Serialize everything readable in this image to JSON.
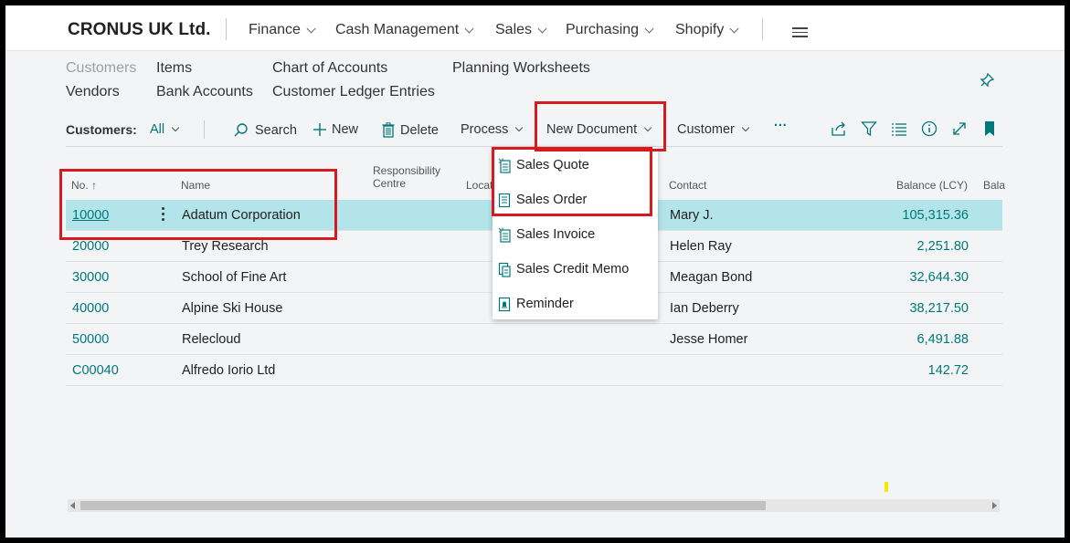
{
  "topnav": {
    "company": "CRONUS UK Ltd.",
    "items": [
      "Finance",
      "Cash Management",
      "Sales",
      "Purchasing",
      "Shopify"
    ]
  },
  "links": {
    "row1": [
      "Customers",
      "Items",
      "Chart of Accounts",
      "Planning Worksheets"
    ],
    "row2": [
      "Vendors",
      "Bank Accounts",
      "Customer Ledger Entries"
    ]
  },
  "actionbar": {
    "page_label": "Customers:",
    "filter": "All",
    "search": "Search",
    "new": "New",
    "delete": "Delete",
    "process": "Process",
    "new_document": "New Document",
    "customer": "Customer",
    "more": "···"
  },
  "dropdown": {
    "items": [
      "Sales Quote",
      "Sales Order",
      "Sales Invoice",
      "Sales Credit Memo",
      "Reminder"
    ]
  },
  "table": {
    "headers": {
      "no": "No. ↑",
      "name": "Name",
      "responsibility": [
        "Responsibility",
        "Centre"
      ],
      "location": "Locat",
      "contact": "Contact",
      "balance_lcy": "Balance (LCY)",
      "balance_due": "Bala"
    },
    "rows": [
      {
        "no": "10000",
        "name": "Adatum Corporation",
        "contact": "Mary J.",
        "balance": "105,315.36"
      },
      {
        "no": "20000",
        "name": "Trey Research",
        "contact": "Helen Ray",
        "balance": "2,251.80"
      },
      {
        "no": "30000",
        "name": "School of Fine Art",
        "contact": "Meagan Bond",
        "balance": "32,644.30"
      },
      {
        "no": "40000",
        "name": "Alpine Ski House",
        "contact": "Ian Deberry",
        "balance": "38,217.50"
      },
      {
        "no": "50000",
        "name": "Relecloud",
        "contact": "Jesse Homer",
        "balance": "6,491.88"
      },
      {
        "no": "C00040",
        "name": "Alfredo Iorio Ltd",
        "contact": "",
        "balance": "142.72"
      }
    ]
  },
  "colors": {
    "accent": "#00787a",
    "selected_row": "#b2e4ea",
    "highlight_border": "#d71920"
  }
}
